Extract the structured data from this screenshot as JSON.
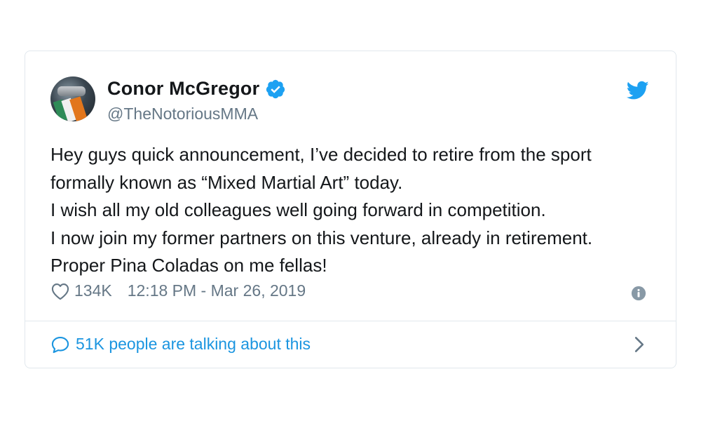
{
  "tweet": {
    "author": {
      "display_name": "Conor McGregor",
      "handle": "@TheNotoriousMMA",
      "verified": true
    },
    "text_lines": [
      "Hey guys quick announcement, I’ve decided to retire from the sport",
      "formally known as “Mixed Martial Art” today.",
      "I wish all my old colleagues well going forward in competition.",
      "I now join my former partners on this venture, already in retirement.",
      "Proper Pina Coladas on me fellas!"
    ],
    "likes": "134K",
    "timestamp": "12:18 PM - Mar 26, 2019",
    "footer": {
      "conversation_label": "51K people are talking about this"
    }
  },
  "icons": {
    "brand": "twitter-bird-icon",
    "verified": "verified-badge-icon",
    "like": "heart-icon",
    "info": "info-icon",
    "conversation": "speech-bubble-icon",
    "chevron": "chevron-right-icon"
  },
  "colors": {
    "accent": "#1da1f2",
    "link": "#1b95e0",
    "text": "#14171a",
    "muted": "#657786",
    "border": "#e1e8ed"
  }
}
